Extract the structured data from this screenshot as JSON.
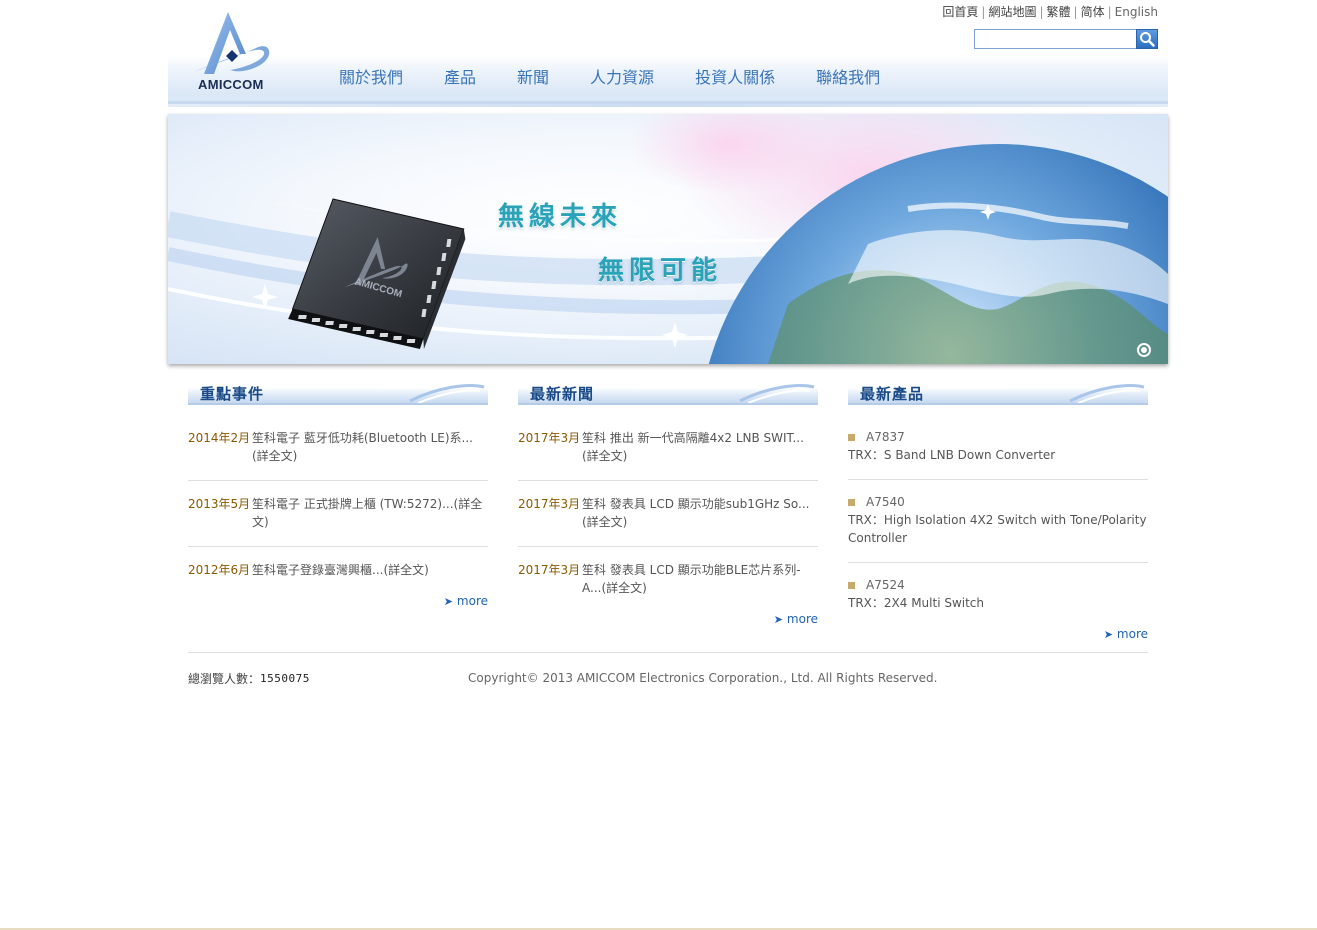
{
  "brand": {
    "logo_text": "AMICCOM"
  },
  "top_links": {
    "home": "回首頁",
    "sitemap": "網站地圖",
    "traditional": "繁體",
    "simplified": "简体",
    "english": "English",
    "separator": "|"
  },
  "search": {
    "value": "",
    "placeholder": ""
  },
  "nav": {
    "items": [
      {
        "label": "關於我們"
      },
      {
        "label": "產品"
      },
      {
        "label": "新聞"
      },
      {
        "label": "人力資源"
      },
      {
        "label": "投資人關係"
      },
      {
        "label": "聯絡我們"
      }
    ]
  },
  "banner": {
    "slogan_line1": "無線未來",
    "slogan_line2": "無限可能",
    "chip_label": "AMICCOM"
  },
  "events": {
    "title": "重點事件",
    "items": [
      {
        "date": "2014年2月",
        "text": "笙科電子 藍牙低功耗(Bluetooth LE)系...(詳全文)"
      },
      {
        "date": "2013年5月",
        "text": "笙科電子 正式掛牌上櫃 (TW:5272)...(詳全文)"
      },
      {
        "date": "2012年6月",
        "text": "笙科電子登錄臺灣興櫃...(詳全文)"
      }
    ],
    "more": "more"
  },
  "news": {
    "title": "最新新聞",
    "items": [
      {
        "date": "2017年3月",
        "text": "笙科 推出 新一代高隔離4x2 LNB SWIT...(詳全文)"
      },
      {
        "date": "2017年3月",
        "text": "笙科 發表具 LCD 顯示功能sub1GHz So...(詳全文)"
      },
      {
        "date": "2017年3月",
        "text": "笙科 發表具 LCD 顯示功能BLE芯片系列-A...(詳全文)"
      }
    ],
    "more": "more"
  },
  "products": {
    "title": "最新產品",
    "items": [
      {
        "name": "A7837",
        "desc": "TRX：S Band LNB Down Converter"
      },
      {
        "name": "A7540",
        "desc": "TRX：High Isolation 4X2 Switch with Tone/Polarity Controller"
      },
      {
        "name": "A7524",
        "desc": "TRX：2X4 Multi Switch"
      }
    ],
    "more": "more"
  },
  "footer": {
    "counter_label": "總瀏覽人數：",
    "counter_value": "1550075",
    "copyright": "Copyright© 2013 AMICCOM Electronics Corporation., Ltd. All Rights Reserved."
  },
  "colors": {
    "nav_text": "#3a74b8",
    "date_text": "#8a5a00",
    "more_link": "#1e62b5",
    "slogan": "#2aa3b8",
    "bullet": "#c7a96c"
  }
}
